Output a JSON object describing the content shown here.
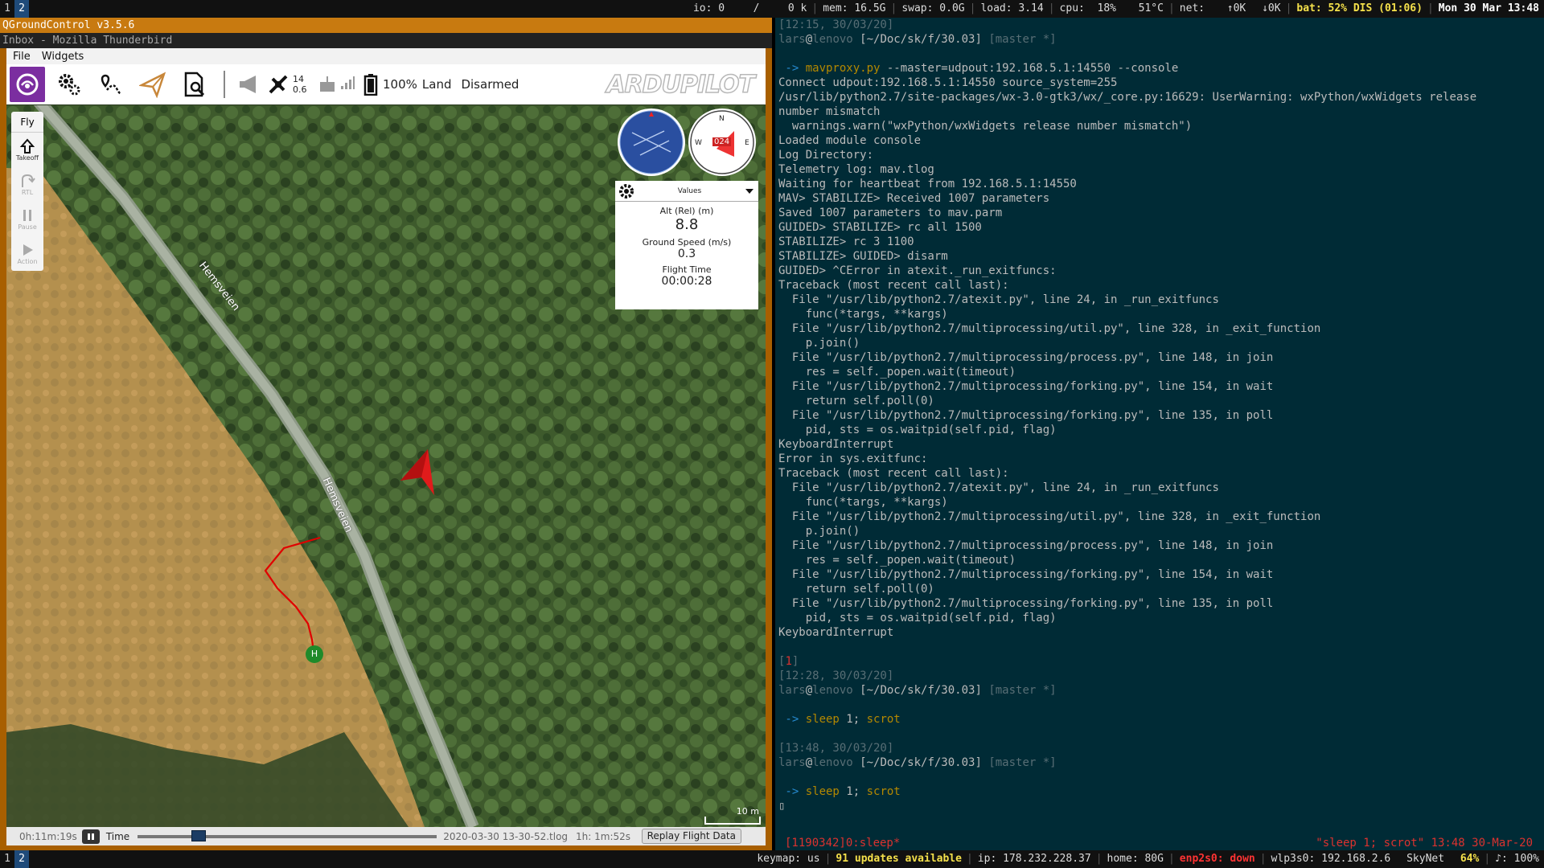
{
  "topbar": {
    "workspaces": [
      "1",
      "2"
    ],
    "status": {
      "io": "io: 0",
      "io_sep": "/",
      "io_k": "0 k",
      "mem": "mem: 16.5G",
      "swap": "swap: 0.0G",
      "load": "load: 3.14",
      "cpu": "cpu:  18%",
      "temp": "51°C",
      "net": "net:",
      "net_up": "↑0K",
      "net_down": "↓0K",
      "bat": "bat: 52% DIS (01:06)",
      "date": "Mon 30 Mar 13:48"
    }
  },
  "left_window": {
    "title": "QGroundControl v3.5.6",
    "secondary_title": "Inbox - Mozilla Thunderbird",
    "menu": [
      "File",
      "Widgets"
    ],
    "toolbar": {
      "sat_count": "14",
      "hdop": "0.6",
      "battery": "100%",
      "mode": "Land",
      "armed": "Disarmed",
      "logo": "ARDUPILOT"
    },
    "fly_panel": {
      "title": "Fly",
      "items": [
        {
          "label": "Takeoff",
          "icon": "takeoff-icon"
        },
        {
          "label": "RTL",
          "icon": "rtl-icon"
        },
        {
          "label": "Pause",
          "icon": "pause-icon"
        },
        {
          "label": "Action",
          "icon": "action-icon"
        }
      ]
    },
    "compass": {
      "heading": "024",
      "n": "N",
      "e": "E",
      "w": "W"
    },
    "values_panel": {
      "header": "Values",
      "alt_label": "Alt (Rel) (m)",
      "alt_value": "8.8",
      "speed_label": "Ground Speed (m/s)",
      "speed_value": "0.3",
      "time_label": "Flight Time",
      "time_value": "00:00:28"
    },
    "map": {
      "road_label": "Hemsveien",
      "home_label": "H",
      "scale": "10 m",
      "colors": {
        "track": "#e00000",
        "vehicle": "#e01b1b",
        "home": "#1f8a2a"
      }
    },
    "replay": {
      "elapsed": "0h:11m:19s",
      "time_label": "Time",
      "file": "2020-03-30 13-30-52.tlog",
      "total": "1h: 1m:52s",
      "button": "Replay Flight Data",
      "progress": 0.19
    }
  },
  "terminal": {
    "lines": [
      [
        {
          "t": "[12:15, 30/03/20]",
          "c": "c-dim"
        }
      ],
      [
        {
          "t": "lars",
          "c": "c-dim"
        },
        {
          "t": "@",
          "c": ""
        },
        {
          "t": "lenovo",
          "c": "c-dim"
        },
        {
          "t": " [~/Doc/sk/f/30.03] ",
          "c": ""
        },
        {
          "t": "[master *]",
          "c": "c-dim"
        }
      ],
      [],
      [
        {
          "t": " -> ",
          "c": "c-blue"
        },
        {
          "t": "mavproxy.py",
          "c": "c-yel"
        },
        {
          "t": " --master=udpout:192.168.5.1:14550 --console",
          "c": ""
        }
      ],
      [
        {
          "t": "Connect udpout:192.168.5.1:14550 source_system=255",
          "c": ""
        }
      ],
      [
        {
          "t": "/usr/lib/python2.7/site-packages/wx-3.0-gtk3/wx/_core.py:16629: UserWarning: wxPython/wxWidgets release",
          "c": ""
        }
      ],
      [
        {
          "t": "number mismatch",
          "c": ""
        }
      ],
      [
        {
          "t": "  warnings.warn(\"wxPython/wxWidgets release number mismatch\")",
          "c": ""
        }
      ],
      [
        {
          "t": "Loaded module console",
          "c": ""
        }
      ],
      [
        {
          "t": "Log Directory:",
          "c": ""
        }
      ],
      [
        {
          "t": "Telemetry log: mav.tlog",
          "c": ""
        }
      ],
      [
        {
          "t": "Waiting for heartbeat from 192.168.5.1:14550",
          "c": ""
        }
      ],
      [
        {
          "t": "MAV> STABILIZE> Received 1007 parameters",
          "c": ""
        }
      ],
      [
        {
          "t": "Saved 1007 parameters to mav.parm",
          "c": ""
        }
      ],
      [
        {
          "t": "GUIDED> STABILIZE> rc all 1500",
          "c": ""
        }
      ],
      [
        {
          "t": "STABILIZE> rc 3 1100",
          "c": ""
        }
      ],
      [
        {
          "t": "STABILIZE> GUIDED> disarm",
          "c": ""
        }
      ],
      [
        {
          "t": "GUIDED> ^CError in atexit._run_exitfuncs:",
          "c": ""
        }
      ],
      [
        {
          "t": "Traceback (most recent call last):",
          "c": ""
        }
      ],
      [
        {
          "t": "  File \"/usr/lib/python2.7/atexit.py\", line 24, in _run_exitfuncs",
          "c": ""
        }
      ],
      [
        {
          "t": "    func(*targs, **kargs)",
          "c": ""
        }
      ],
      [
        {
          "t": "  File \"/usr/lib/python2.7/multiprocessing/util.py\", line 328, in _exit_function",
          "c": ""
        }
      ],
      [
        {
          "t": "    p.join()",
          "c": ""
        }
      ],
      [
        {
          "t": "  File \"/usr/lib/python2.7/multiprocessing/process.py\", line 148, in join",
          "c": ""
        }
      ],
      [
        {
          "t": "    res = self._popen.wait(timeout)",
          "c": ""
        }
      ],
      [
        {
          "t": "  File \"/usr/lib/python2.7/multiprocessing/forking.py\", line 154, in wait",
          "c": ""
        }
      ],
      [
        {
          "t": "    return self.poll(0)",
          "c": ""
        }
      ],
      [
        {
          "t": "  File \"/usr/lib/python2.7/multiprocessing/forking.py\", line 135, in poll",
          "c": ""
        }
      ],
      [
        {
          "t": "    pid, sts = os.waitpid(self.pid, flag)",
          "c": ""
        }
      ],
      [
        {
          "t": "KeyboardInterrupt",
          "c": ""
        }
      ],
      [
        {
          "t": "Error in sys.exitfunc:",
          "c": ""
        }
      ],
      [
        {
          "t": "Traceback (most recent call last):",
          "c": ""
        }
      ],
      [
        {
          "t": "  File \"/usr/lib/python2.7/atexit.py\", line 24, in _run_exitfuncs",
          "c": ""
        }
      ],
      [
        {
          "t": "    func(*targs, **kargs)",
          "c": ""
        }
      ],
      [
        {
          "t": "  File \"/usr/lib/python2.7/multiprocessing/util.py\", line 328, in _exit_function",
          "c": ""
        }
      ],
      [
        {
          "t": "    p.join()",
          "c": ""
        }
      ],
      [
        {
          "t": "  File \"/usr/lib/python2.7/multiprocessing/process.py\", line 148, in join",
          "c": ""
        }
      ],
      [
        {
          "t": "    res = self._popen.wait(timeout)",
          "c": ""
        }
      ],
      [
        {
          "t": "  File \"/usr/lib/python2.7/multiprocessing/forking.py\", line 154, in wait",
          "c": ""
        }
      ],
      [
        {
          "t": "    return self.poll(0)",
          "c": ""
        }
      ],
      [
        {
          "t": "  File \"/usr/lib/python2.7/multiprocessing/forking.py\", line 135, in poll",
          "c": ""
        }
      ],
      [
        {
          "t": "    pid, sts = os.waitpid(self.pid, flag)",
          "c": ""
        }
      ],
      [
        {
          "t": "KeyboardInterrupt",
          "c": ""
        }
      ],
      [],
      [
        {
          "t": "[",
          "c": "c-dim"
        },
        {
          "t": "1",
          "c": "c-red"
        },
        {
          "t": "]",
          "c": "c-dim"
        }
      ],
      [
        {
          "t": "[12:28, 30/03/20]",
          "c": "c-dim"
        }
      ],
      [
        {
          "t": "lars",
          "c": "c-dim"
        },
        {
          "t": "@",
          "c": ""
        },
        {
          "t": "lenovo",
          "c": "c-dim"
        },
        {
          "t": " [~/Doc/sk/f/30.03] ",
          "c": ""
        },
        {
          "t": "[master *]",
          "c": "c-dim"
        }
      ],
      [],
      [
        {
          "t": " -> ",
          "c": "c-blue"
        },
        {
          "t": "sleep",
          "c": "c-yel"
        },
        {
          "t": " 1; ",
          "c": ""
        },
        {
          "t": "scrot",
          "c": "c-yel"
        }
      ],
      [],
      [
        {
          "t": "[13:48, 30/03/20]",
          "c": "c-dim"
        }
      ],
      [
        {
          "t": "lars",
          "c": "c-dim"
        },
        {
          "t": "@",
          "c": ""
        },
        {
          "t": "lenovo",
          "c": "c-dim"
        },
        {
          "t": " [~/Doc/sk/f/30.03] ",
          "c": ""
        },
        {
          "t": "[master *]",
          "c": "c-dim"
        }
      ],
      [],
      [
        {
          "t": " -> ",
          "c": "c-blue"
        },
        {
          "t": "sleep",
          "c": "c-yel"
        },
        {
          "t": " 1; ",
          "c": ""
        },
        {
          "t": "scrot",
          "c": "c-yel"
        }
      ],
      [
        {
          "t": "▯",
          "c": ""
        }
      ]
    ],
    "tmux_left": "[1190342]0:sleep*",
    "tmux_right": "\"sleep 1; scrot\" 13:48 30-Mar-20"
  },
  "bottombar": {
    "workspaces": [
      "1",
      "2"
    ],
    "keymap": "keymap: us",
    "updates": "91 updates available",
    "ip": "ip: 178.232.228.37",
    "home": "home: 80G",
    "eth": "enp2s0: down",
    "wifi": "wlp3s0: 192.168.2.6",
    "ssid": "SkyNet",
    "wifi_pct": "64%",
    "volume": "♪: 100%"
  }
}
